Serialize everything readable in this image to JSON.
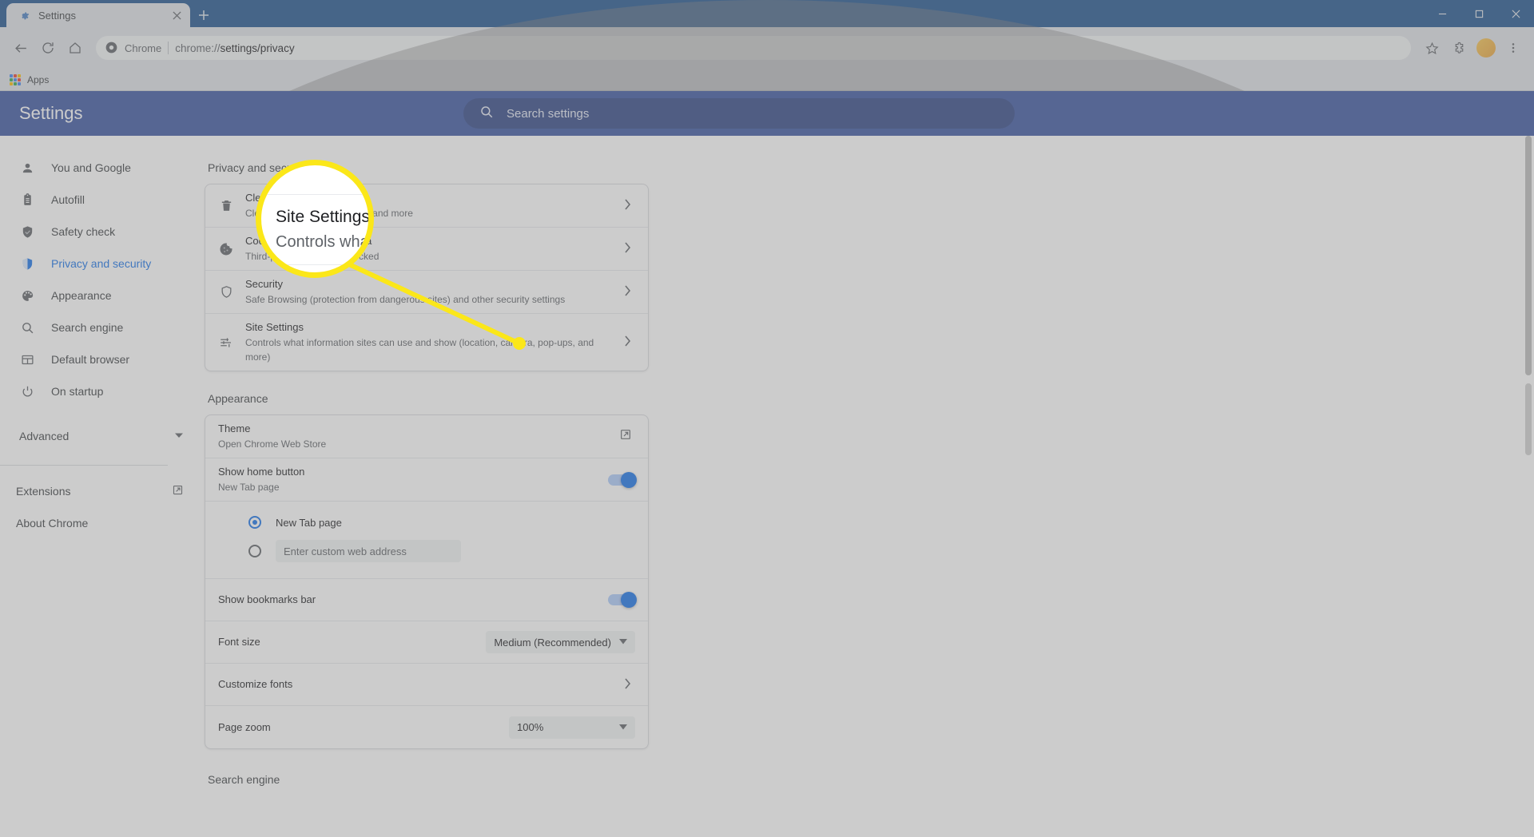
{
  "window": {
    "tab": {
      "title": "Settings",
      "favicon_icon": "gear-icon",
      "close_icon": "close-icon"
    },
    "new_tab_icon": "plus-icon",
    "controls": {
      "minimize": "minimize-icon",
      "maximize": "maximize-icon",
      "close": "window-close-icon"
    }
  },
  "toolbar": {
    "back_icon": "arrow-back-icon",
    "forward_icon": "arrow-forward-icon",
    "reload_icon": "reload-icon",
    "home_icon": "home-icon",
    "omnibox": {
      "brand_icon": "chrome-logo-icon",
      "brand_label": "Chrome",
      "url_prefix": "chrome://",
      "url_bold": "settings/privacy"
    },
    "bookmark_icon": "star-icon",
    "extensions_icon": "puzzle-piece-icon",
    "profile_icon": "avatar",
    "menu_icon": "three-dot-menu-icon"
  },
  "bookmarks_bar": {
    "apps_icon": "apps-grid-icon",
    "apps_label": "Apps"
  },
  "settings": {
    "title": "Settings",
    "search": {
      "icon": "search-icon",
      "placeholder": "Search settings",
      "value": ""
    },
    "sidebar": {
      "items": [
        {
          "label": "You and Google",
          "icon": "person-icon",
          "active": false
        },
        {
          "label": "Autofill",
          "icon": "clipboard-icon",
          "active": false
        },
        {
          "label": "Safety check",
          "icon": "shield-check-icon",
          "active": false
        },
        {
          "label": "Privacy and security",
          "icon": "shield-half-icon",
          "active": true
        },
        {
          "label": "Appearance",
          "icon": "palette-icon",
          "active": false
        },
        {
          "label": "Search engine",
          "icon": "search-icon",
          "active": false
        },
        {
          "label": "Default browser",
          "icon": "browser-window-icon",
          "active": false
        },
        {
          "label": "On startup",
          "icon": "power-icon",
          "active": false
        }
      ],
      "advanced": {
        "label": "Advanced",
        "icon": "chevron-down-icon"
      },
      "links": [
        {
          "label": "Extensions",
          "icon": "external-link-icon"
        },
        {
          "label": "About Chrome",
          "icon": ""
        }
      ]
    },
    "privacy_section": {
      "heading": "Privacy and security",
      "rows": [
        {
          "icon": "trash-icon",
          "title": "Clear browsing data",
          "subtitle": "Clear history, cookies, cache, and more",
          "control": "chevron-right-icon"
        },
        {
          "icon": "cookie-icon",
          "title": "Cookies and other site data",
          "subtitle": "Third-party cookies are blocked",
          "control": "chevron-right-icon"
        },
        {
          "icon": "shield-icon",
          "title": "Security",
          "subtitle": "Safe Browsing (protection from dangerous sites) and other security settings",
          "control": "chevron-right-icon"
        },
        {
          "icon": "sliders-icon",
          "title": "Site Settings",
          "subtitle": "Controls what information sites can use and show (location, camera, pop-ups, and more)",
          "control": "chevron-right-icon"
        }
      ]
    },
    "appearance_section": {
      "heading": "Appearance",
      "theme": {
        "title": "Theme",
        "subtitle": "Open Chrome Web Store",
        "control": "external-link-icon"
      },
      "show_home_button": {
        "title": "Show home button",
        "subtitle": "New Tab page",
        "toggle_on": true
      },
      "home_options": {
        "new_tab": {
          "label": "New Tab page",
          "selected": true
        },
        "custom": {
          "label": "",
          "selected": false,
          "placeholder": "Enter custom web address",
          "value": ""
        }
      },
      "show_bookmarks_bar": {
        "title": "Show bookmarks bar",
        "toggle_on": true
      },
      "font_size": {
        "title": "Font size",
        "value": "Medium (Recommended)",
        "caret": "chevron-down-icon"
      },
      "customize_fonts": {
        "title": "Customize fonts",
        "control": "chevron-right-icon"
      },
      "page_zoom": {
        "title": "Page zoom",
        "value": "100%",
        "caret": "chevron-down-icon"
      }
    },
    "search_engine_section": {
      "heading": "Search engine"
    }
  },
  "callout": {
    "magnified_title": "Site Settings",
    "magnified_subtitle": "Controls wha",
    "highlight_color": "#fbe719"
  },
  "colors": {
    "settings_header": "#3b55a0",
    "tabstrip": "#21548e",
    "accent": "#1a73e8",
    "highlight": "#fbe719",
    "toolbar": "#dee1e6"
  }
}
